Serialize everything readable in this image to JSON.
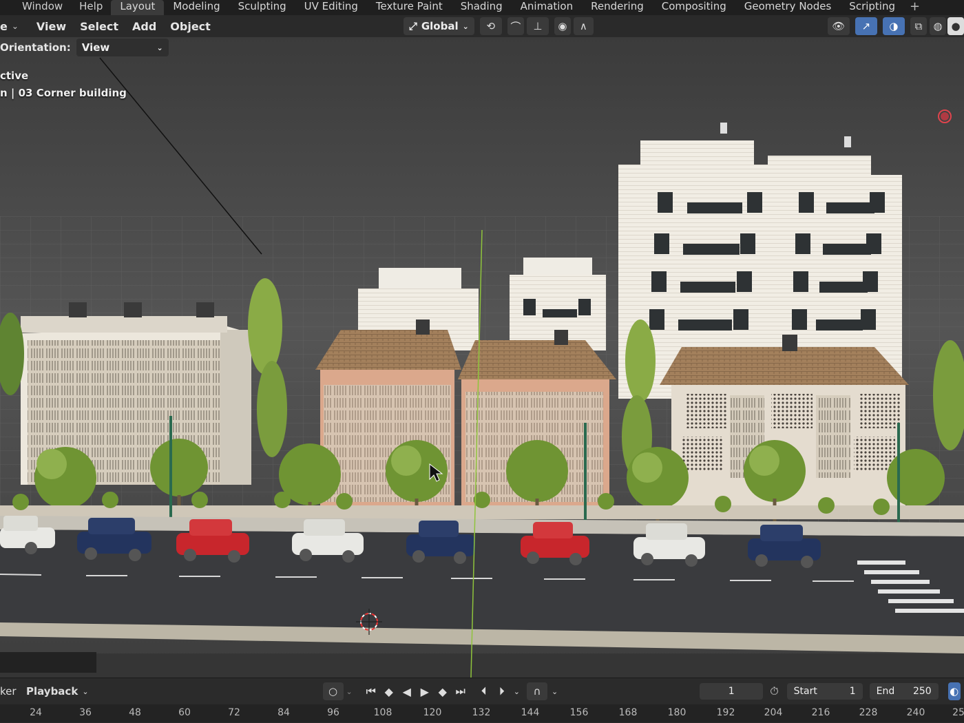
{
  "top_menu": {
    "items": [
      "Window",
      "Help"
    ],
    "workspaces": [
      "Layout",
      "Modeling",
      "Sculpting",
      "UV Editing",
      "Texture Paint",
      "Shading",
      "Animation",
      "Rendering",
      "Compositing",
      "Geometry Nodes",
      "Scripting"
    ],
    "active_workspace": "Layout",
    "add_tab_symbol": "+"
  },
  "viewport_header": {
    "mode_fragment": "e",
    "menus": [
      "View",
      "Select",
      "Add",
      "Object"
    ],
    "transform_orientation": "Global",
    "orientation_label": "Orientation:",
    "orientation_value": "View"
  },
  "viewport_info": {
    "line1": "ctive",
    "line2": "n | 03 Corner building"
  },
  "timeline": {
    "editor_fragment": "ker",
    "playback_label": "Playback",
    "current_frame": "1",
    "start_label": "Start",
    "start_value": "1",
    "end_label": "End",
    "end_value": "250",
    "ruler_ticks": [
      "24",
      "36",
      "48",
      "60",
      "72",
      "84",
      "96",
      "108",
      "120",
      "132",
      "144",
      "156",
      "168",
      "180",
      "192",
      "204",
      "216",
      "228",
      "240",
      "25"
    ]
  },
  "colors": {
    "accent_blue": "#4772b3",
    "car_red": "#c8262c",
    "car_navy": "#23345e",
    "car_white": "#e8e8e4",
    "roof_tile": "#9a7a58",
    "facade_pink": "#dca88e",
    "tree_green": "#7fa03a"
  }
}
